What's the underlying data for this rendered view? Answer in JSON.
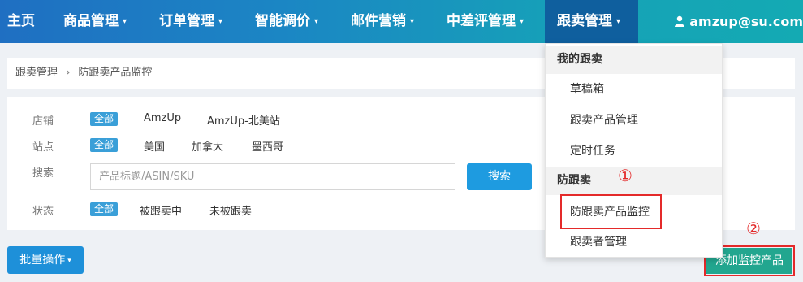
{
  "nav": {
    "home": "主页",
    "items": [
      {
        "label": "商品管理"
      },
      {
        "label": "订单管理"
      },
      {
        "label": "智能调价"
      },
      {
        "label": "邮件营销"
      },
      {
        "label": "中差评管理"
      },
      {
        "label": "跟卖管理"
      }
    ],
    "caret": "▾",
    "user": "amzup@su.com",
    "active_color": "#0f5f9e"
  },
  "breadcrumb": {
    "root": "跟卖管理",
    "separator": "›",
    "current": "防跟卖产品监控"
  },
  "filters": {
    "store": {
      "label": "店铺",
      "all": "全部",
      "options": [
        "AmzUp",
        "AmzUp-北美站"
      ]
    },
    "site": {
      "label": "站点",
      "all": "全部",
      "options": [
        "美国",
        "加拿大",
        "墨西哥"
      ]
    },
    "search": {
      "label": "搜索",
      "placeholder": "产品标题/ASIN/SKU",
      "button": "搜索"
    },
    "status": {
      "label": "状态",
      "all": "全部",
      "options": [
        "被跟卖中",
        "未被跟卖"
      ]
    }
  },
  "actions": {
    "bulk": "批量操作",
    "add": "添加监控产品"
  },
  "dropdown": {
    "group1": "我的跟卖",
    "group1_items": [
      "草稿箱",
      "跟卖产品管理",
      "定时任务"
    ],
    "group2": "防跟卖",
    "group2_items": [
      "防跟卖产品监控",
      "跟卖者管理"
    ]
  },
  "annotations": {
    "step1": "①",
    "step2": "②",
    "color": "#e42a2a"
  },
  "icons": {
    "user": "user-icon",
    "caret": "chevron-down-icon",
    "separator": "chevron-right-icon"
  }
}
